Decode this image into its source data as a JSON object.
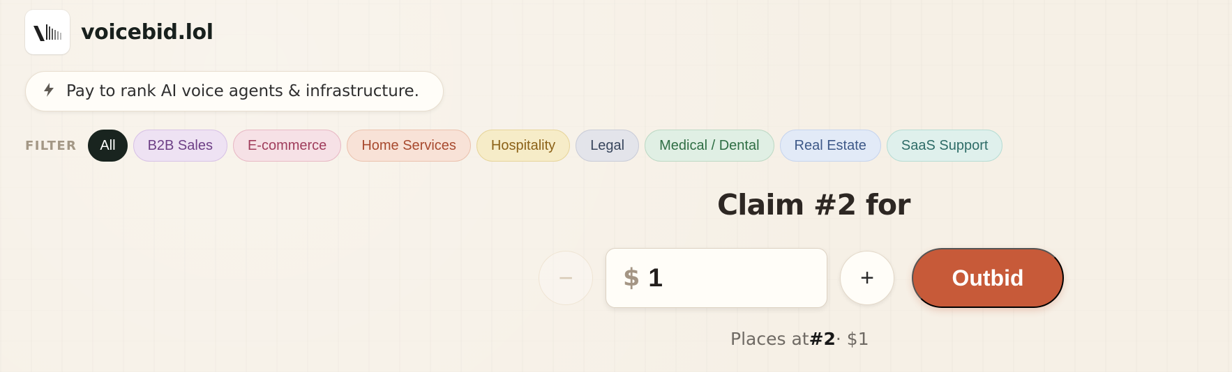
{
  "brand": {
    "name": "voicebid.lol",
    "logo_icon": "voicebid-logo-icon"
  },
  "tagline": {
    "icon": "bolt-icon",
    "text": "Pay to rank AI voice agents & infrastructure."
  },
  "filters": {
    "label": "FILTER",
    "items": [
      {
        "label": "All",
        "active": true
      },
      {
        "label": "B2B Sales",
        "active": false
      },
      {
        "label": "E-commerce",
        "active": false
      },
      {
        "label": "Home Services",
        "active": false
      },
      {
        "label": "Hospitality",
        "active": false
      },
      {
        "label": "Legal",
        "active": false
      },
      {
        "label": "Medical / Dental",
        "active": false
      },
      {
        "label": "Real Estate",
        "active": false
      },
      {
        "label": "SaaS Support",
        "active": false
      }
    ]
  },
  "bid": {
    "title": "Claim #2 for",
    "minus_label": "−",
    "currency": "$",
    "amount": "1",
    "plus_label": "+",
    "outbid_label": "Outbid",
    "places_prefix": "Places at ",
    "places_rank": "#2",
    "places_suffix": " · $1"
  },
  "colors": {
    "background": "#f6f0e6",
    "accent": "#c75a39",
    "dark": "#19241f"
  }
}
